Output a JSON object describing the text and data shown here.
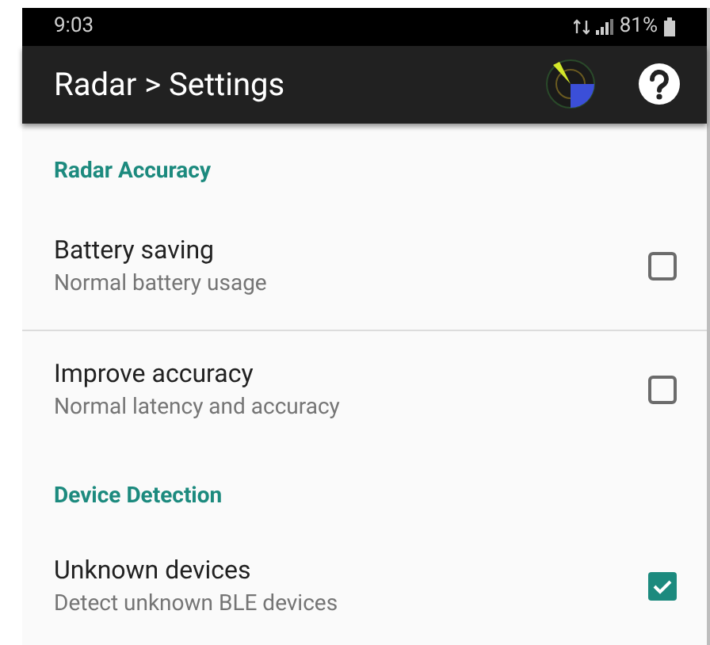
{
  "status_bar": {
    "time": "9:03",
    "battery": "81%"
  },
  "app_bar": {
    "title": "Radar > Settings"
  },
  "sections": [
    {
      "title": "Radar Accuracy",
      "items": [
        {
          "title": "Battery saving",
          "summary": "Normal battery usage",
          "checked": false
        },
        {
          "title": "Improve accuracy",
          "summary": "Normal latency and accuracy",
          "checked": false
        }
      ]
    },
    {
      "title": "Device Detection",
      "items": [
        {
          "title": "Unknown devices",
          "summary": "Detect unknown BLE devices",
          "checked": true
        }
      ]
    }
  ]
}
